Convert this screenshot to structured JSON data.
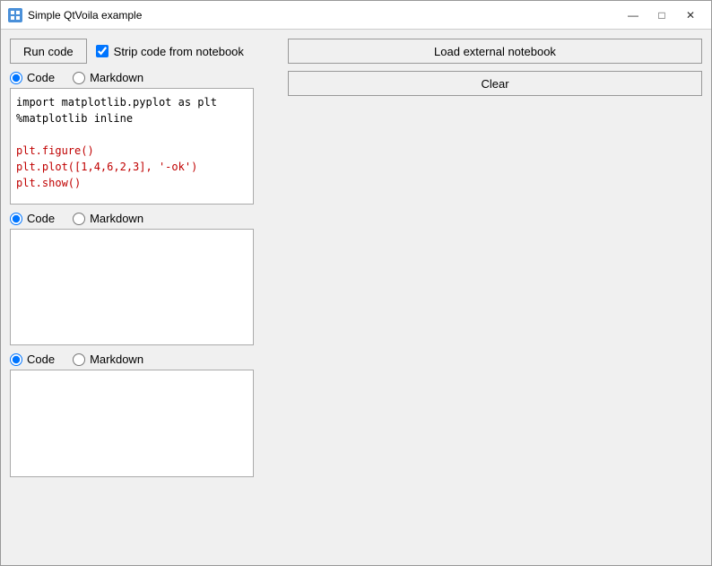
{
  "window": {
    "title": "Simple QtVoila example",
    "icon": "window-icon"
  },
  "titlebar": {
    "minimize_label": "—",
    "maximize_label": "□",
    "close_label": "✕"
  },
  "toolbar": {
    "run_code_label": "Run code",
    "strip_code_label": "Strip code from notebook",
    "strip_code_checked": true
  },
  "buttons": {
    "load_external_label": "Load external notebook",
    "clear_label": "Clear"
  },
  "cell1": {
    "radio_code_label": "Code",
    "radio_markdown_label": "Markdown",
    "radio_selected": "code",
    "code_lines": [
      {
        "text": "import matplotlib.pyplot as plt",
        "color": "normal"
      },
      {
        "text": "%matplotlib inline",
        "color": "normal"
      },
      {
        "text": "",
        "color": "normal"
      },
      {
        "text": "plt.figure()",
        "color": "red"
      },
      {
        "text": "plt.plot([1,4,6,2,3], '-ok')",
        "color": "red"
      },
      {
        "text": "plt.show()",
        "color": "red"
      }
    ]
  },
  "cell2": {
    "radio_code_label": "Code",
    "radio_markdown_label": "Markdown",
    "radio_selected": "code",
    "code_content": ""
  },
  "cell3": {
    "radio_code_label": "Code",
    "radio_markdown_label": "Markdown",
    "radio_selected": "code",
    "code_content": ""
  }
}
